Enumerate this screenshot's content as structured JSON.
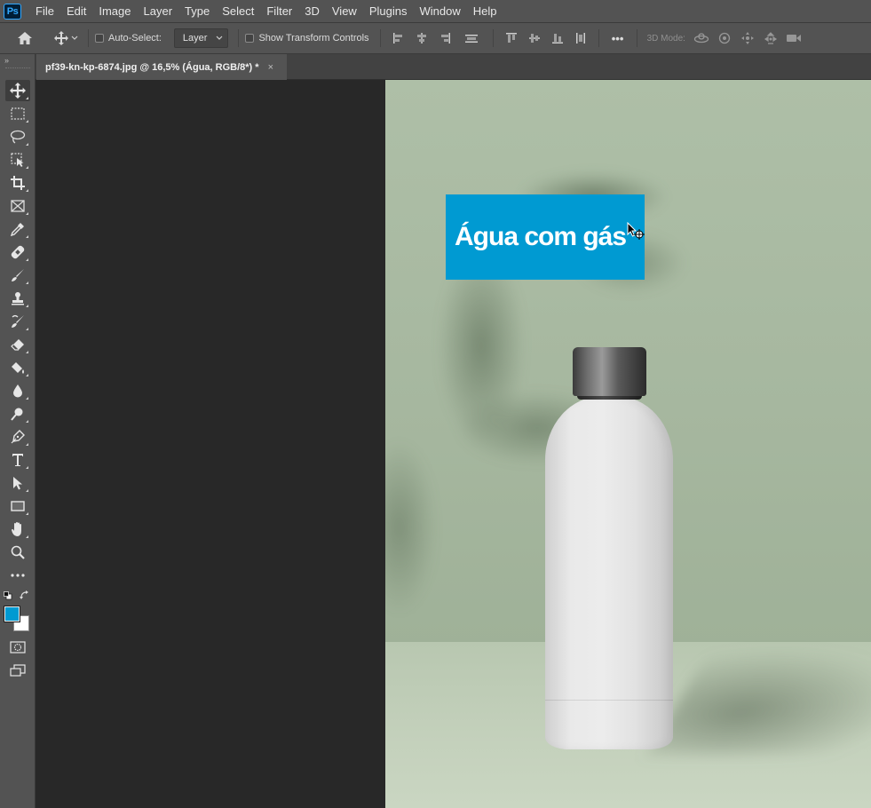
{
  "app": {
    "logo_text": "Ps"
  },
  "menu": [
    "File",
    "Edit",
    "Image",
    "Layer",
    "Type",
    "Select",
    "Filter",
    "3D",
    "View",
    "Plugins",
    "Window",
    "Help"
  ],
  "options_bar": {
    "auto_select_label": "Auto-Select:",
    "auto_select_checked": false,
    "auto_select_target": "Layer",
    "transform_controls_label": "Show Transform Controls",
    "transform_controls_checked": false,
    "more_label": "•••",
    "mode_3d_label": "3D Mode:"
  },
  "toolbar": {
    "collapse_glyph": "»",
    "tools": [
      "move-tool",
      "rectangular-marquee-tool",
      "lasso-tool",
      "object-selection-tool",
      "crop-tool",
      "frame-tool",
      "eyedropper-tool",
      "healing-brush-tool",
      "brush-tool",
      "clone-stamp-tool",
      "history-brush-tool",
      "eraser-tool",
      "paint-bucket-tool",
      "blur-tool",
      "dodge-tool",
      "pen-tool",
      "type-tool",
      "path-selection-tool",
      "rectangle-tool",
      "hand-tool",
      "zoom-tool",
      "edit-toolbar"
    ],
    "active_tool": "move-tool",
    "foreground_color": "#009ad2",
    "background_color": "#ffffff"
  },
  "document": {
    "tab_title": "pf39-kn-kp-6874.jpg @ 16,5% (Água, RGB/8*) *",
    "close_glyph": "×"
  },
  "canvas": {
    "text_layer": "Água com gás",
    "text_layer_color": "#009ad2"
  }
}
